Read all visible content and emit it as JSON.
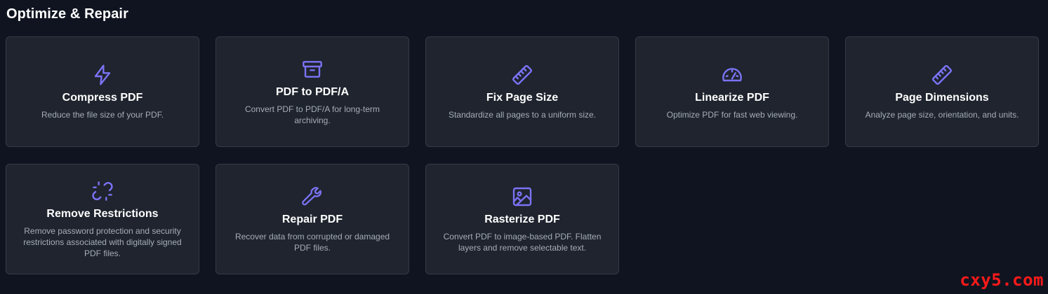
{
  "section": {
    "title": "Optimize & Repair"
  },
  "accent_color": "#7b73f5",
  "cards": [
    {
      "icon": "lightning-icon",
      "title": "Compress PDF",
      "desc": "Reduce the file size of your PDF."
    },
    {
      "icon": "archive-icon",
      "title": "PDF to PDF/A",
      "desc": "Convert PDF to PDF/A for long-term archiving."
    },
    {
      "icon": "ruler-icon",
      "title": "Fix Page Size",
      "desc": "Standardize all pages to a uniform size."
    },
    {
      "icon": "gauge-icon",
      "title": "Linearize PDF",
      "desc": "Optimize PDF for fast web viewing."
    },
    {
      "icon": "ruler-icon",
      "title": "Page Dimensions",
      "desc": "Analyze page size, orientation, and units."
    },
    {
      "icon": "broken-link-icon",
      "title": "Remove Restrictions",
      "desc": "Remove password protection and security restrictions associated with digitally signed PDF files."
    },
    {
      "icon": "wrench-icon",
      "title": "Repair PDF",
      "desc": "Recover data from corrupted or damaged PDF files."
    },
    {
      "icon": "image-icon",
      "title": "Rasterize PDF",
      "desc": "Convert PDF to image-based PDF. Flatten layers and remove selectable text."
    }
  ],
  "watermark": {
    "text": "cxy5.com"
  }
}
